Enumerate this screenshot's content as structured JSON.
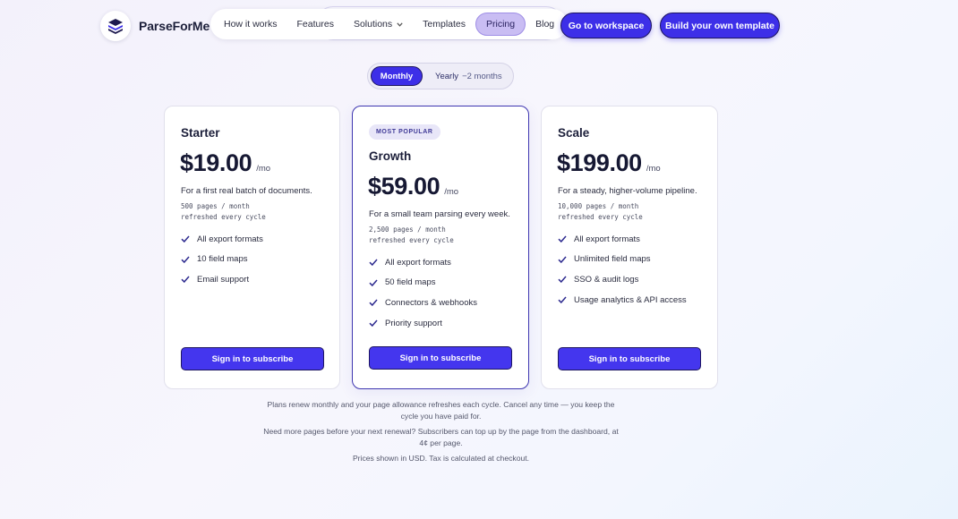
{
  "brand": {
    "name": "ParseForMe"
  },
  "nav": {
    "items": [
      {
        "label": "How it works"
      },
      {
        "label": "Features"
      },
      {
        "label": "Solutions"
      },
      {
        "label": "Templates"
      },
      {
        "label": "Pricing",
        "active": true
      },
      {
        "label": "Blog"
      }
    ]
  },
  "header": {
    "workspace_label": "Go to workspace",
    "build_label": "Build your own template"
  },
  "billing_toggle": {
    "monthly_label": "Monthly",
    "yearly_label": "Yearly",
    "yearly_savings": "−2 months",
    "selected": "Monthly"
  },
  "plans": [
    {
      "name": "Starter",
      "price": "$19.00",
      "unit": "/mo",
      "description": "For a first real batch of documents.",
      "allowance_line1": "500 pages / month",
      "allowance_line2": "refreshed every cycle",
      "features": [
        "All export formats",
        "10 field maps",
        "Email support"
      ],
      "cta": "Sign in to subscribe"
    },
    {
      "name": "Growth",
      "badge": "MOST POPULAR",
      "price": "$59.00",
      "unit": "/mo",
      "description": "For a small team parsing every week.",
      "allowance_line1": "2,500 pages / month",
      "allowance_line2": "refreshed every cycle",
      "features": [
        "All export formats",
        "50 field maps",
        "Connectors & webhooks",
        "Priority support"
      ],
      "cta": "Sign in to subscribe"
    },
    {
      "name": "Scale",
      "price": "$199.00",
      "unit": "/mo",
      "description": "For a steady, higher-volume pipeline.",
      "allowance_line1": "10,000 pages / month",
      "allowance_line2": "refreshed every cycle",
      "features": [
        "All export formats",
        "Unlimited field maps",
        "SSO & audit logs",
        "Usage analytics & API access"
      ],
      "cta": "Sign in to subscribe"
    }
  ],
  "footnotes": {
    "renewal": "Plans renew monthly and your page allowance refreshes each cycle. Cancel any time — you keep the cycle you have paid for.",
    "topup": "Need more pages before your next renewal? Subscribers can top up by the page from the dashboard, at 4¢ per page.",
    "tax": "Prices shown in USD. Tax is calculated at checkout."
  },
  "colors": {
    "accent": "#3d2fe8",
    "accent_border": "#1d1560",
    "pricing_tab": "#c9bdf3",
    "badge_bg": "#e8e6f8"
  }
}
